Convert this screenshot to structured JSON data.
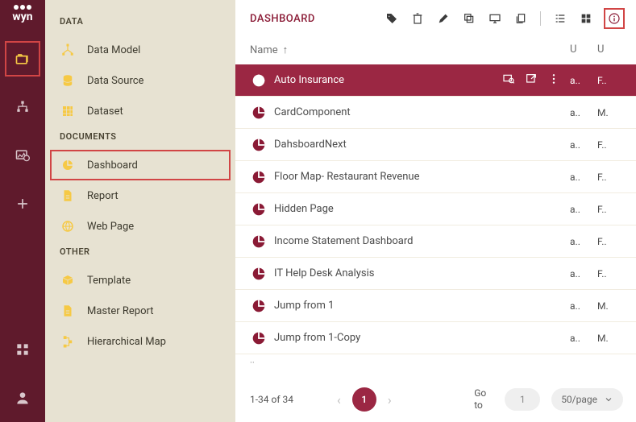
{
  "brand": "wyn",
  "sidenav": {
    "groups": [
      {
        "label": "DATA",
        "items": [
          {
            "id": "data-model",
            "label": "Data Model",
            "icon": "network"
          },
          {
            "id": "data-source",
            "label": "Data Source",
            "icon": "database"
          },
          {
            "id": "dataset",
            "label": "Dataset",
            "icon": "grid"
          }
        ]
      },
      {
        "label": "DOCUMENTS",
        "items": [
          {
            "id": "dashboard",
            "label": "Dashboard",
            "icon": "pie",
            "highlighted": true
          },
          {
            "id": "report",
            "label": "Report",
            "icon": "file"
          },
          {
            "id": "web-page",
            "label": "Web Page",
            "icon": "globe"
          }
        ]
      },
      {
        "label": "OTHER",
        "items": [
          {
            "id": "template",
            "label": "Template",
            "icon": "box"
          },
          {
            "id": "master-report",
            "label": "Master Report",
            "icon": "file"
          },
          {
            "id": "hierarchical-map",
            "label": "Hierarchical Map",
            "icon": "hmap"
          }
        ]
      }
    ]
  },
  "panel": {
    "title": "DASHBOARD",
    "columns": {
      "name": "Name",
      "sort": "↑",
      "u1": "U",
      "u2": "U"
    },
    "rows": [
      {
        "name": "Auto Insurance",
        "u1": "a..",
        "u2": "F..",
        "selected": true
      },
      {
        "name": "CardComponent",
        "u1": "a..",
        "u2": "M."
      },
      {
        "name": "DahsboardNext",
        "u1": "a..",
        "u2": "F.."
      },
      {
        "name": "Floor Map- Restaurant Revenue",
        "u1": "a..",
        "u2": "F.."
      },
      {
        "name": "Hidden Page",
        "u1": "a..",
        "u2": "F.."
      },
      {
        "name": "Income Statement Dashboard",
        "u1": "a..",
        "u2": "F.."
      },
      {
        "name": "IT Help Desk Analysis",
        "u1": "a..",
        "u2": "F.."
      },
      {
        "name": "Jump from 1",
        "u1": "a..",
        "u2": "M."
      },
      {
        "name": "Jump from 1-Copy",
        "u1": "a..",
        "u2": "M."
      }
    ],
    "more_indicator": "··"
  },
  "footer": {
    "range": "1-34 of 34",
    "current_page": "1",
    "goto_label": "Go to",
    "goto_value": "1",
    "per_page": "50/page"
  }
}
